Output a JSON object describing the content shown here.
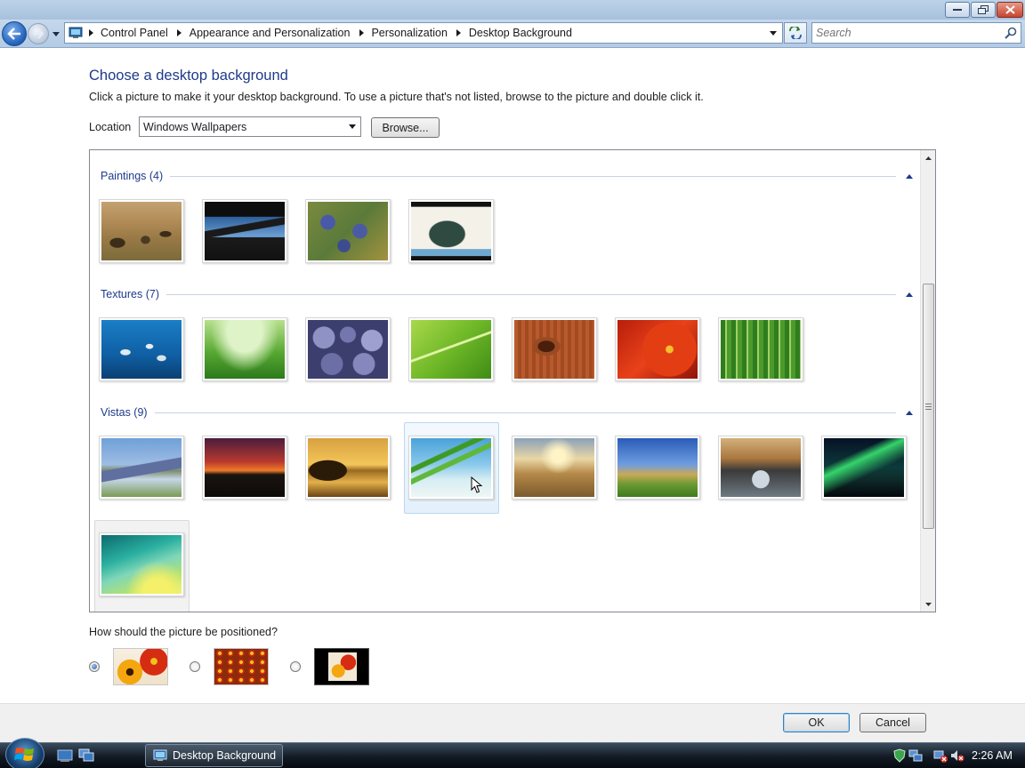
{
  "window": {
    "min_label": "minimize",
    "max_label": "maximize",
    "close_label": "close"
  },
  "navigation": {
    "breadcrumbs": [
      "Control Panel",
      "Appearance and Personalization",
      "Personalization",
      "Desktop Background"
    ],
    "search_placeholder": "Search"
  },
  "header": {
    "title": "Choose a desktop background",
    "description": "Click a picture to make it your desktop background. To use a picture that's not listed, browse to the picture and double click it."
  },
  "location": {
    "label": "Location",
    "value": "Windows Wallpapers",
    "browse_label": "Browse..."
  },
  "gallery": {
    "groups": [
      {
        "title": "Paintings (4)",
        "items": [
          "painting-1",
          "painting-2",
          "painting-3",
          "painting-4"
        ]
      },
      {
        "title": "Textures (7)",
        "items": [
          "texture-1",
          "texture-2",
          "texture-3",
          "texture-4",
          "texture-5",
          "texture-6",
          "texture-7"
        ]
      },
      {
        "title": "Vistas (9)",
        "items": [
          "vista-1",
          "vista-2",
          "vista-3",
          "vista-4",
          "vista-5",
          "vista-6",
          "vista-7",
          "vista-8",
          "vista-9"
        ]
      }
    ],
    "hovered_item": "vista-4",
    "selected_item": "vista-9"
  },
  "positioning": {
    "label": "How should the picture be positioned?",
    "options": [
      "fit-to-screen",
      "tile",
      "center"
    ],
    "selected": "fit-to-screen"
  },
  "footer": {
    "ok_label": "OK",
    "cancel_label": "Cancel"
  },
  "taskbar": {
    "task_label": "Desktop Background",
    "clock": "2:26 AM"
  },
  "colors": {
    "heading_blue": "#1e3a8a",
    "focus_blue": "#3c7fb1"
  }
}
